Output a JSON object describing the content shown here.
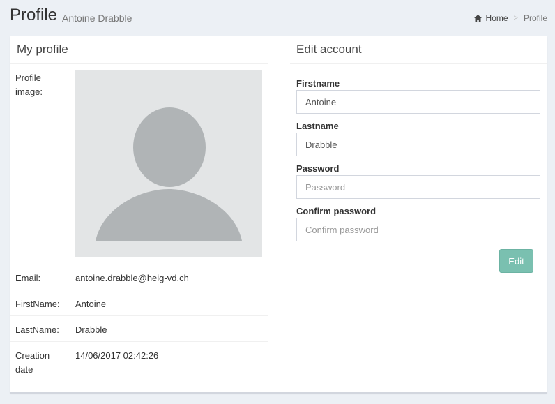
{
  "header": {
    "title": "Profile",
    "subtitle": "Antoine Drabble",
    "breadcrumb": {
      "home_icon": "home-icon",
      "home": "Home",
      "separator": ">",
      "current": "Profile"
    }
  },
  "profile": {
    "title": "My profile",
    "image_label": "Profile image:",
    "avatar_icon": "user-silhouette-icon",
    "email_label": "Email:",
    "email": "antoine.drabble@heig-vd.ch",
    "firstname_label": "FirstName:",
    "firstname": "Antoine",
    "lastname_label": "LastName:",
    "lastname": "Drabble",
    "creation_label": "Creation date",
    "creation_date": "14/06/2017 02:42:26"
  },
  "edit": {
    "title": "Edit account",
    "firstname_label": "Firstname",
    "firstname_value": "Antoine",
    "lastname_label": "Lastname",
    "lastname_value": "Drabble",
    "password_label": "Password",
    "password_placeholder": "Password",
    "confirm_label": "Confirm password",
    "confirm_placeholder": "Confirm password",
    "button": "Edit"
  },
  "colors": {
    "background": "#ecf0f5",
    "button": "#7ac0b0",
    "avatar_bg": "#e3e5e6",
    "avatar_fg": "#b0b4b6"
  }
}
